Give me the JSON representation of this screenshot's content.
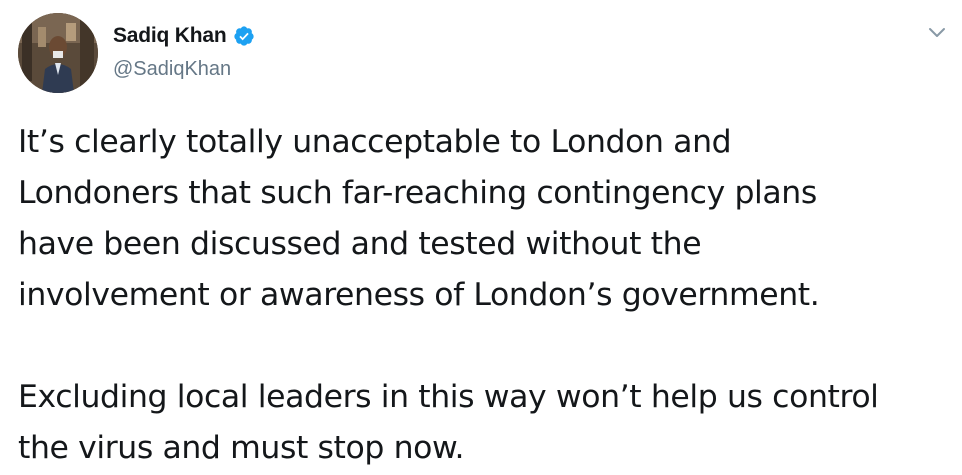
{
  "author": {
    "display_name": "Sadiq Khan",
    "handle": "@SadiqKhan",
    "verified": true,
    "avatar_icon": "profile-photo"
  },
  "menu": {
    "icon": "chevron-down-icon"
  },
  "tweet": {
    "paragraphs": [
      {
        "lines": [
          "It’s clearly totally unacceptable to London and",
          "Londoners that such far-reaching contingency plans",
          "have been discussed and tested without the",
          "involvement or awareness of London’s government."
        ]
      },
      {
        "lines": [
          "Excluding local leaders in this way won’t help us control",
          "the virus and must stop now."
        ]
      }
    ]
  },
  "colors": {
    "text": "#14171a",
    "secondary": "#657786",
    "verified_badge": "#1da1f2",
    "background": "#ffffff"
  }
}
